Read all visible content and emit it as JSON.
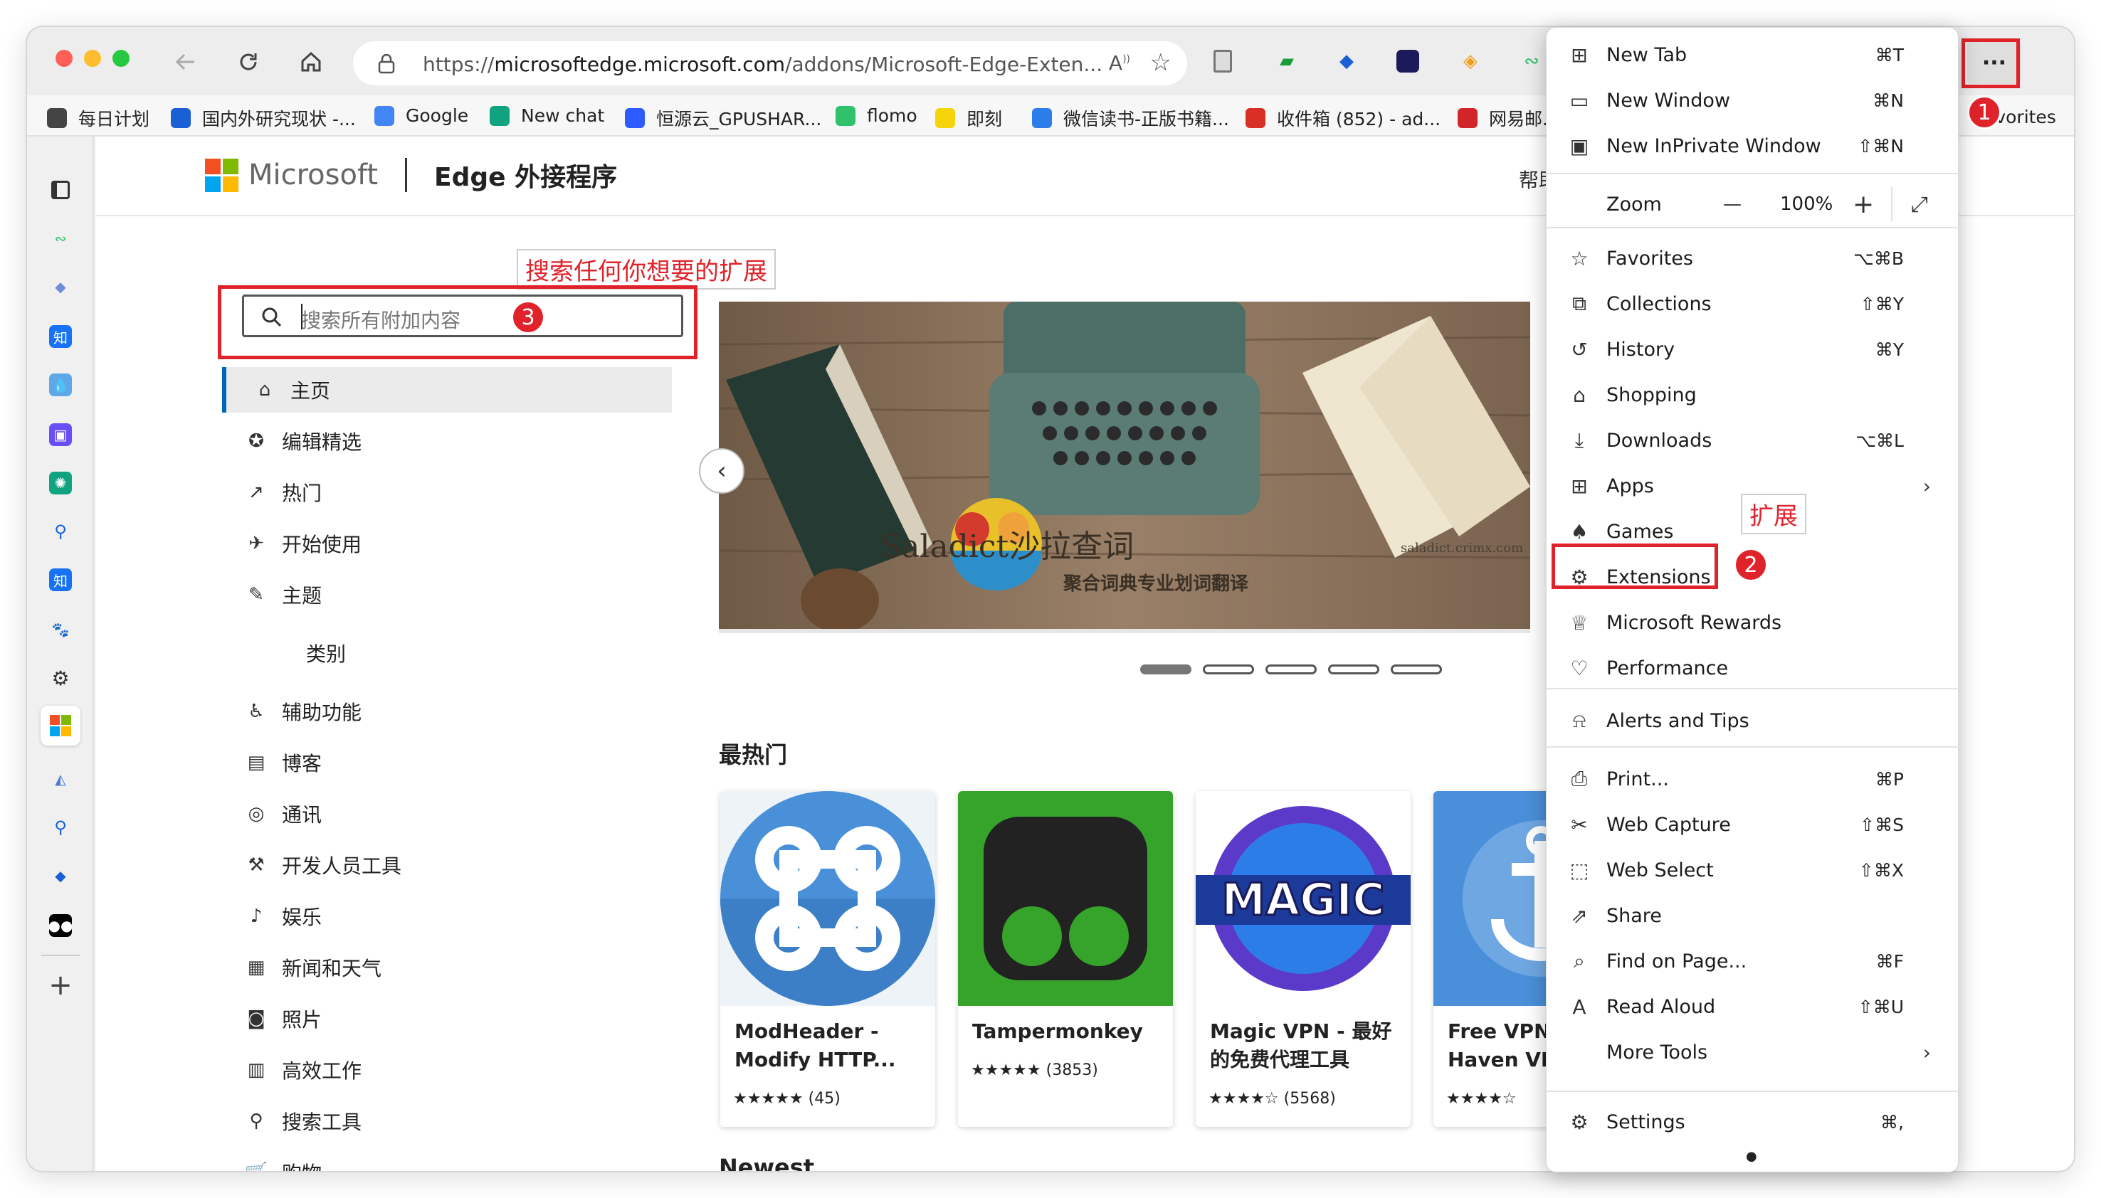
{
  "toolbar": {
    "url_prefix": "https://",
    "url_domain": "microsoftedge.microsoft.com",
    "url_path": "/addons/Microsoft-Edge-Exten...",
    "more_button": "···"
  },
  "favorites": [
    {
      "label": "每日计划",
      "color": "#444"
    },
    {
      "label": "国内外研究现状 -...",
      "color": "#1a5fd6"
    },
    {
      "label": "Google",
      "color": "#4285f4"
    },
    {
      "label": "New chat",
      "color": "#10a37f"
    },
    {
      "label": "恒源云_GPUSHAR...",
      "color": "#2e5bff"
    },
    {
      "label": "flomo",
      "color": "#30c26b"
    },
    {
      "label": "即刻",
      "color": "#f5d50a"
    },
    {
      "label": "微信读书-正版书籍...",
      "color": "#2b7de9"
    },
    {
      "label": "收件箱 (852) - ad...",
      "color": "#d93025"
    },
    {
      "label": "网易邮...",
      "color": "#d1252a"
    }
  ],
  "favorites_overflow": "avorites",
  "header": {
    "brand": "Microsoft",
    "title": "Edge 外接程序",
    "help": "帮助"
  },
  "search": {
    "placeholder": "搜索所有附加内容"
  },
  "annotations": {
    "search_note": "搜索任何你想要的扩展",
    "extensions_note": "扩展",
    "badge1": "1",
    "badge2": "2",
    "badge3": "3"
  },
  "sidenav": {
    "primary": [
      {
        "label": "主页",
        "icon": "home-icon"
      },
      {
        "label": "编辑精选",
        "icon": "award-icon"
      },
      {
        "label": "热门",
        "icon": "trending-icon"
      },
      {
        "label": "开始使用",
        "icon": "rocket-icon"
      },
      {
        "label": "主题",
        "icon": "brush-icon"
      }
    ],
    "category_heading": "类别",
    "categories": [
      {
        "label": "辅助功能",
        "icon": "accessibility-icon"
      },
      {
        "label": "博客",
        "icon": "blog-icon"
      },
      {
        "label": "通讯",
        "icon": "communication-icon"
      },
      {
        "label": "开发人员工具",
        "icon": "dev-tools-icon"
      },
      {
        "label": "娱乐",
        "icon": "entertainment-icon"
      },
      {
        "label": "新闻和天气",
        "icon": "news-icon"
      },
      {
        "label": "照片",
        "icon": "photo-icon"
      },
      {
        "label": "高效工作",
        "icon": "productivity-icon"
      },
      {
        "label": "搜索工具",
        "icon": "search-tools-icon"
      },
      {
        "label": "购物",
        "icon": "shopping-icon"
      }
    ]
  },
  "hero": {
    "title": "Saladict沙拉查词",
    "subtitle": "聚合词典专业划词翻译",
    "site": "saladict.crimx.com"
  },
  "sections": {
    "popular": "最热门",
    "newest": "Newest"
  },
  "cards": [
    {
      "name": "ModHeader - Modify HTTP...",
      "stars": "★★★★★",
      "count": "(45)"
    },
    {
      "name": "Tampermonkey",
      "stars": "★★★★★",
      "count": "(3853)"
    },
    {
      "name": "Magic VPN - 最好的免费代理工具",
      "stars": "★★★★☆",
      "count": "(5568)"
    },
    {
      "name": "Free VPN For Haven VPN",
      "stars": "★★★★☆",
      "count": ""
    }
  ],
  "menu": {
    "items": [
      {
        "label": "New Tab",
        "shortcut": "⌘T",
        "icon": "new-tab-icon"
      },
      {
        "label": "New Window",
        "shortcut": "⌘N",
        "icon": "new-window-icon"
      },
      {
        "label": "New InPrivate Window",
        "shortcut": "⇧⌘N",
        "icon": "inprivate-icon"
      }
    ],
    "zoom": {
      "label": "Zoom",
      "value": "100%",
      "minus": "—",
      "plus": "+"
    },
    "group2": [
      {
        "label": "Favorites",
        "shortcut": "⌥⌘B",
        "icon": "favorites-icon"
      },
      {
        "label": "Collections",
        "shortcut": "⇧⌘Y",
        "icon": "collections-icon"
      },
      {
        "label": "History",
        "shortcut": "⌘Y",
        "icon": "history-icon"
      },
      {
        "label": "Shopping",
        "shortcut": "",
        "icon": "shopping-tag-icon"
      },
      {
        "label": "Downloads",
        "shortcut": "⌥⌘L",
        "icon": "download-icon"
      },
      {
        "label": "Apps",
        "shortcut": "",
        "icon": "apps-icon"
      },
      {
        "label": "Games",
        "shortcut": "",
        "icon": "games-icon"
      },
      {
        "label": "Extensions",
        "shortcut": "",
        "icon": "extensions-icon"
      },
      {
        "label": "Microsoft Rewards",
        "shortcut": "",
        "icon": "rewards-icon"
      },
      {
        "label": "Performance",
        "shortcut": "",
        "icon": "performance-icon"
      }
    ],
    "alerts": {
      "label": "Alerts and Tips",
      "icon": "bell-icon"
    },
    "group4": [
      {
        "label": "Print...",
        "shortcut": "⌘P",
        "icon": "print-icon"
      },
      {
        "label": "Web Capture",
        "shortcut": "⇧⌘S",
        "icon": "web-capture-icon"
      },
      {
        "label": "Web Select",
        "shortcut": "⇧⌘X",
        "icon": "web-select-icon"
      },
      {
        "label": "Share",
        "shortcut": "",
        "icon": "share-icon"
      },
      {
        "label": "Find on Page...",
        "shortcut": "⌘F",
        "icon": "find-icon"
      },
      {
        "label": "Read Aloud",
        "shortcut": "⇧⌘U",
        "icon": "read-aloud-icon"
      },
      {
        "label": "More Tools",
        "shortcut": "",
        "icon": "more-tools-icon"
      }
    ],
    "settings": {
      "label": "Settings",
      "shortcut": "⌘,",
      "icon": "settings-icon"
    }
  },
  "colors": {
    "annotation_red": "#e0232b",
    "accent": "#0067b8"
  }
}
